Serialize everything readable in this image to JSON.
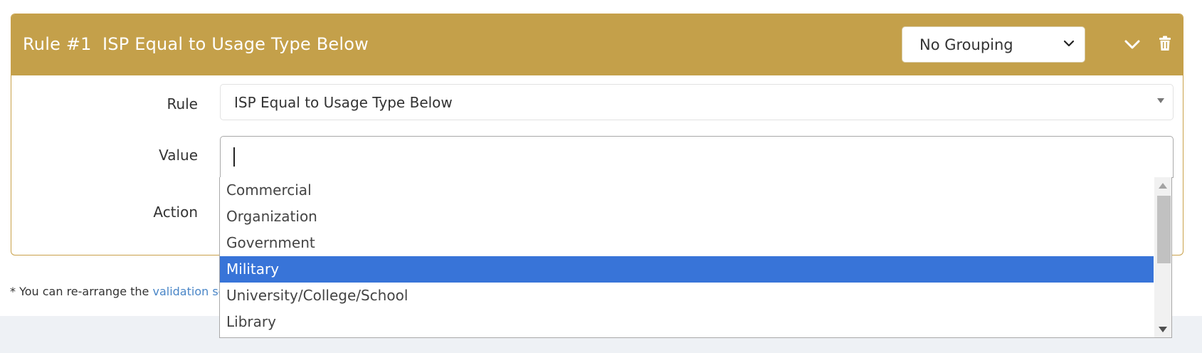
{
  "rule": {
    "number_label": "Rule #1",
    "title": "ISP Equal to Usage Type Below",
    "grouping": {
      "selected": "No Grouping",
      "icon": "chevron-down-icon"
    },
    "header_icons": [
      "chevron-down-icon",
      "trash-icon"
    ]
  },
  "form": {
    "rule_label": "Rule",
    "rule_value": "ISP Equal to Usage Type Below",
    "value_label": "Value",
    "value_input": "",
    "action_label": "Action"
  },
  "dropdown": {
    "items": [
      "Commercial",
      "Organization",
      "Government",
      "Military",
      "University/College/School",
      "Library"
    ],
    "selected_index": 3,
    "scroll_fraction": 0.0
  },
  "footnote": {
    "text": "* You can re-arrange the ",
    "link": "validation sequ"
  },
  "colors": {
    "header_bg": "#c4a04a",
    "selected_bg": "#3874d8",
    "link": "#4a86c7"
  }
}
